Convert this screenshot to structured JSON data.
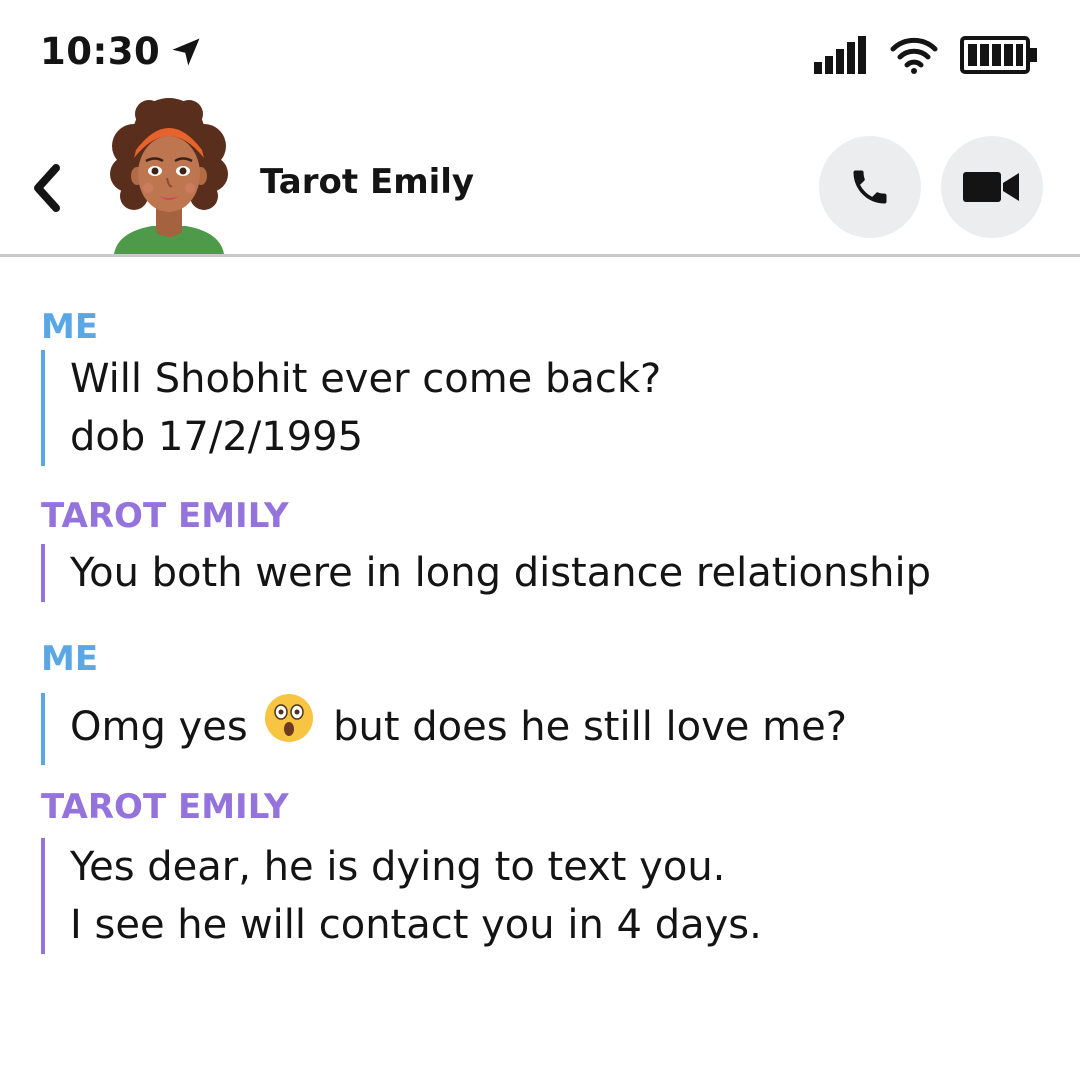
{
  "status_bar": {
    "time": "10:30",
    "icons": [
      "location-arrow-icon",
      "signal-icon",
      "wifi-icon",
      "battery-icon"
    ]
  },
  "header": {
    "contact_name": "Tarot Emily",
    "back_icon": "chevron-left-icon",
    "phone_icon": "phone-icon",
    "video_icon": "video-camera-icon"
  },
  "messages": [
    {
      "sender": "ME",
      "lines": [
        "Will Shobhit ever come back?",
        "dob 17/2/1995"
      ]
    },
    {
      "sender": "TAROT EMILY",
      "lines": [
        "You both were in long distance relationship"
      ]
    },
    {
      "sender": "ME",
      "lines": [
        "Omg yes",
        "but does he still love me?"
      ],
      "emoji": "astonished-face-emoji"
    },
    {
      "sender": "TAROT EMILY",
      "lines": [
        "Yes dear, he is dying to text you.",
        "I see he will contact you in 4 days."
      ]
    }
  ],
  "colors": {
    "me": "#5aa7e6",
    "emily": "#9573dd",
    "button_bg": "#ebedef",
    "divider": "#c9c9c9"
  }
}
